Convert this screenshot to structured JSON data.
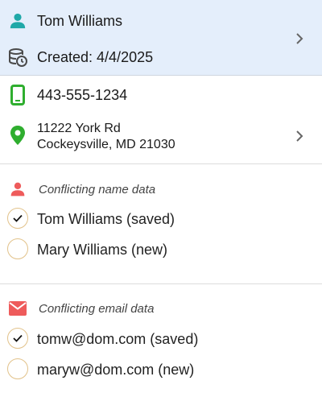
{
  "contact": {
    "name": "Tom Williams",
    "created": "Created: 4/4/2025"
  },
  "details": {
    "phone": "443-555-1234",
    "address_line1": "11222 York Rd",
    "address_line2": "Cockeysville, MD 21030"
  },
  "name_conflict": {
    "label": "Conflicting name data",
    "options": [
      {
        "label": "Tom Williams (saved)",
        "selected": true
      },
      {
        "label": "Mary Williams (new)",
        "selected": false
      }
    ]
  },
  "email_conflict": {
    "label": "Conflicting email data",
    "options": [
      {
        "label": "tomw@dom.com (saved)",
        "selected": true
      },
      {
        "label": "maryw@dom.com (new)",
        "selected": false
      }
    ]
  },
  "colors": {
    "header_bg": "#e4eefb",
    "person_icon": "#1fa8a8",
    "phone_icon": "#2fae2f",
    "location_icon": "#2fae2f",
    "conflict_icon": "#ee5b5b",
    "radio_border": "#e2c28a"
  },
  "icons": {
    "person": "person-icon",
    "created": "database-clock-icon",
    "phone": "phone-icon",
    "location": "location-pin-icon",
    "conflict_name": "person-icon",
    "conflict_email": "mail-icon",
    "chevron": "chevron-right-icon",
    "check": "check-icon"
  }
}
